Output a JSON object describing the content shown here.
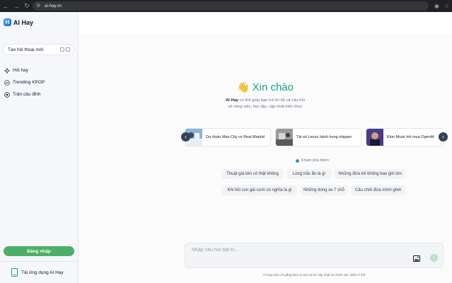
{
  "browser": {
    "url": "ai-hay.vn",
    "back_icon": "arrow-left-icon",
    "forward_icon": "arrow-right-icon",
    "reload_icon": "reload-icon"
  },
  "sidebar": {
    "logo_letter": "H",
    "logo_text": "AI Hay",
    "new_chat_label": "Tạo hội thoại mới",
    "items": [
      {
        "label": "Hỏi hay",
        "icon": "sparkle-icon"
      },
      {
        "label": "Trending KPOP",
        "icon": "trending-icon"
      },
      {
        "label": "Trận cầu đỉnh",
        "icon": "soccer-ball-icon"
      }
    ],
    "login_label": "Đăng nhập",
    "download_label": "Tải ứng dụng AI Hay"
  },
  "main": {
    "greeting_emoji": "👋",
    "greeting": "Xin chào",
    "intro_brand": "AI Hay",
    "intro_line1": " có thể giúp bạn trả lời tất cả câu hỏi",
    "intro_line2": "về công việc, học tập, cập nhật kiến thức",
    "cards": [
      {
        "text": "Dự đoán Man City vs Real Madrid"
      },
      {
        "text": "Tài xế Lexus hành hung shipper"
      },
      {
        "text": "Elon Musk hỏi mua OpenAI"
      }
    ],
    "explore_label": "Khám phá thêm:",
    "chips": [
      "Thuật giả kim có thật không",
      "Lòng trắc ẩn là gì",
      "Những đứa trẻ không bao giờ lớn",
      "Khi hỏi con gái cười có nghĩa là gì",
      "Những dòng xe 7 chỗ",
      "Câu chửi đứa mình ghét"
    ],
    "input_placeholder": "Nhập câu hỏi bất kì...",
    "disclaimer": "AI Hay luôn cố gắng đưa ra câu trả lời cập nhật và chính xác nhất có thể"
  },
  "colors": {
    "accent": "#16a085",
    "login_button": "#4caf66"
  }
}
